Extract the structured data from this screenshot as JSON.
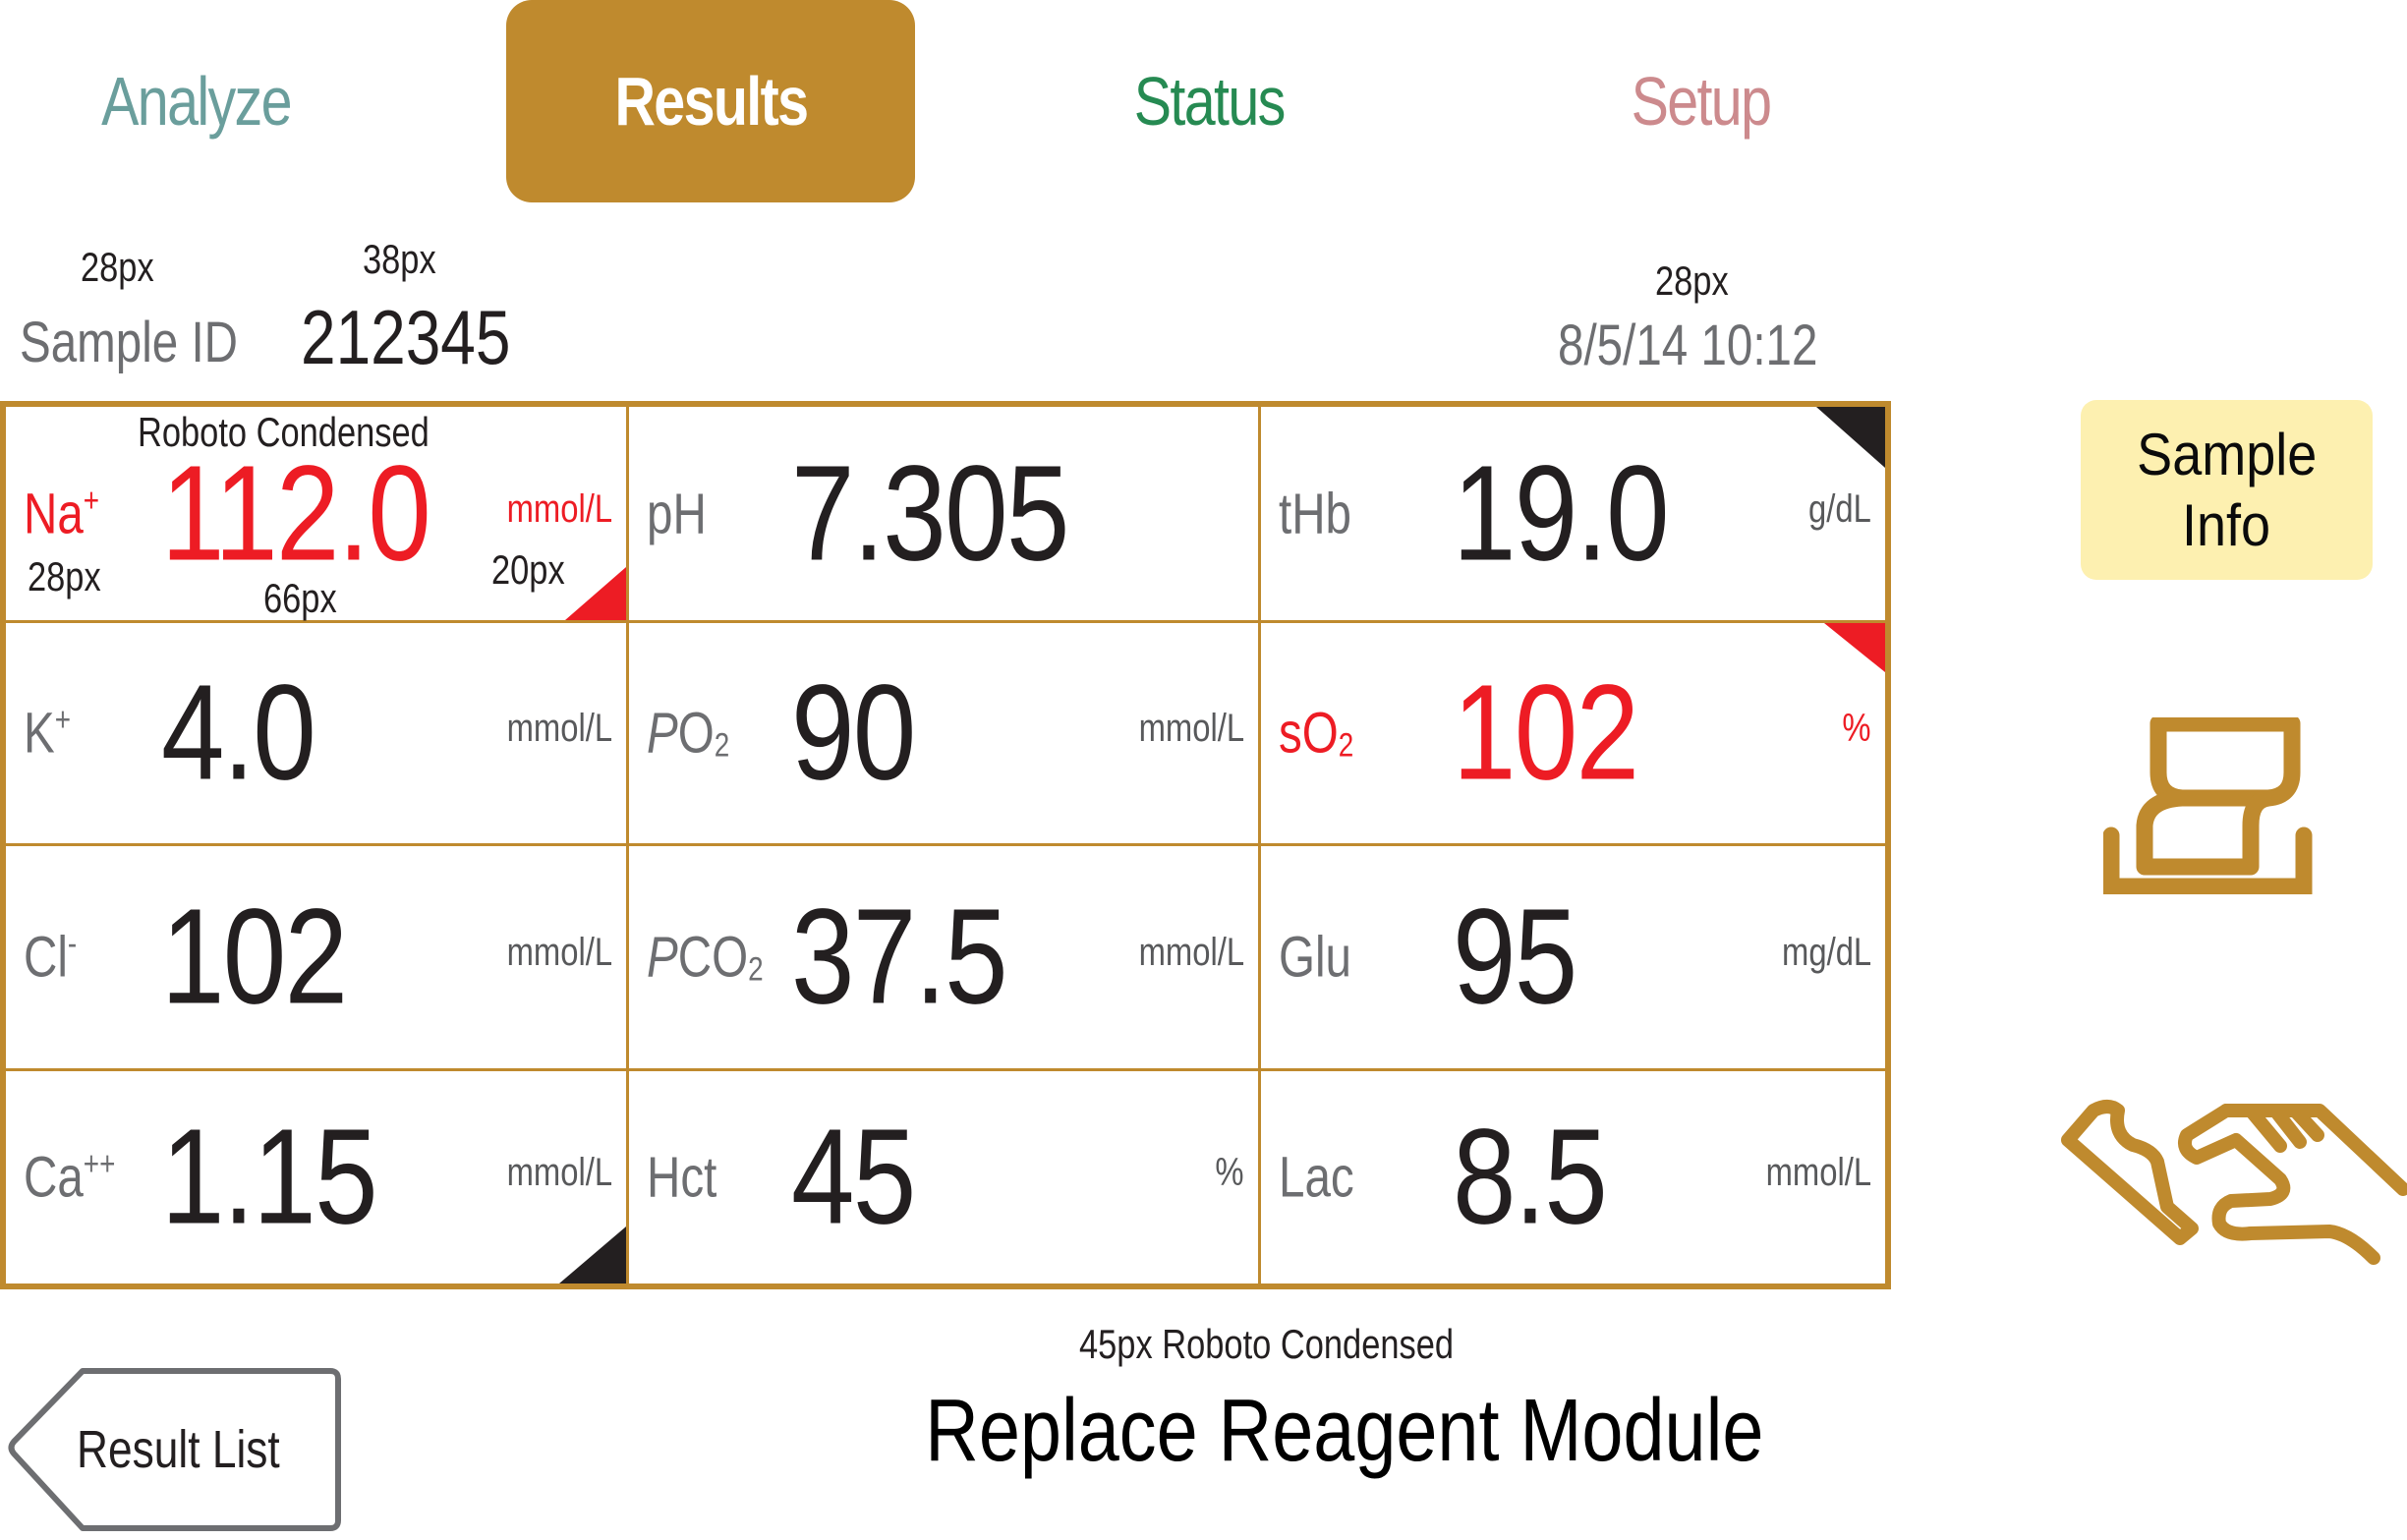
{
  "nav": {
    "tabs": [
      {
        "label": "Analyze",
        "active": false,
        "color": "#6a9e9c"
      },
      {
        "label": "Results",
        "active": true,
        "color": "#ffffff",
        "background": "#bf8a2e"
      },
      {
        "label": "Status",
        "active": false,
        "color": "#268a52"
      },
      {
        "label": "Setup",
        "active": false,
        "color": "#cc8a8d"
      }
    ]
  },
  "annotations": {
    "sample_id_label_size": "28px",
    "sample_id_value_size": "38px",
    "date_size": "28px",
    "font_name": "Roboto Condensed",
    "analyte_label_size": "28px",
    "value_size": "66px",
    "unit_size": "20px",
    "message_spec": "45px Roboto Condensed"
  },
  "sample": {
    "id_label": "Sample ID",
    "id_value": "212345",
    "datetime": "8/5/14 10:12"
  },
  "results": [
    {
      "name": "Na",
      "charge": "+",
      "sub": "",
      "value": "112.0",
      "unit": "mmol/L",
      "status": "alert",
      "flag": "red-bottom-right"
    },
    {
      "name": "pH",
      "charge": "",
      "sub": "",
      "value": "7.305",
      "unit": "",
      "status": "normal",
      "flag": ""
    },
    {
      "name": "tHb",
      "charge": "",
      "sub": "",
      "value": "19.0",
      "unit": "g/dL",
      "status": "normal",
      "flag": "black-top-right"
    },
    {
      "name": "K",
      "charge": "+",
      "sub": "",
      "value": "4.0",
      "unit": "mmol/L",
      "status": "normal",
      "flag": ""
    },
    {
      "name": "PO",
      "charge": "",
      "sub": "2",
      "value": "90",
      "unit": "mmol/L",
      "status": "normal",
      "flag": ""
    },
    {
      "name": "sO",
      "charge": "",
      "sub": "2",
      "value": "102",
      "unit": "%",
      "status": "alert",
      "flag": "red-top-right"
    },
    {
      "name": "Cl",
      "charge": "-",
      "sub": "",
      "value": "102",
      "unit": "mmol/L",
      "status": "normal",
      "flag": ""
    },
    {
      "name": "PCO",
      "charge": "",
      "sub": "2",
      "value": "37.5",
      "unit": "mmol/L",
      "status": "normal",
      "flag": ""
    },
    {
      "name": "Glu",
      "charge": "",
      "sub": "",
      "value": "95",
      "unit": "mg/dL",
      "status": "normal",
      "flag": ""
    },
    {
      "name": "Ca",
      "charge": "++",
      "sub": "",
      "value": "1.15",
      "unit": "mmol/L",
      "status": "normal",
      "flag": "black-bottom-right"
    },
    {
      "name": "Hct",
      "charge": "",
      "sub": "",
      "value": "45",
      "unit": "%",
      "status": "normal",
      "flag": ""
    },
    {
      "name": "Lac",
      "charge": "",
      "sub": "",
      "value": "8.5",
      "unit": "mmol/L",
      "status": "normal",
      "flag": ""
    }
  ],
  "side_panel": {
    "sample_info_line1": "Sample",
    "sample_info_line2": "Info",
    "print_icon": "printer-icon",
    "reagent_icon": "hand-insert-module-icon"
  },
  "footer": {
    "result_list_label": "Result List",
    "message": "Replace Reagent Module"
  },
  "colors": {
    "accent": "#bf8a2e",
    "alert": "#ed1c24",
    "sample_info_bg": "#fdf0b0",
    "label_gray": "#6d6e71",
    "value_dark": "#231f20"
  }
}
